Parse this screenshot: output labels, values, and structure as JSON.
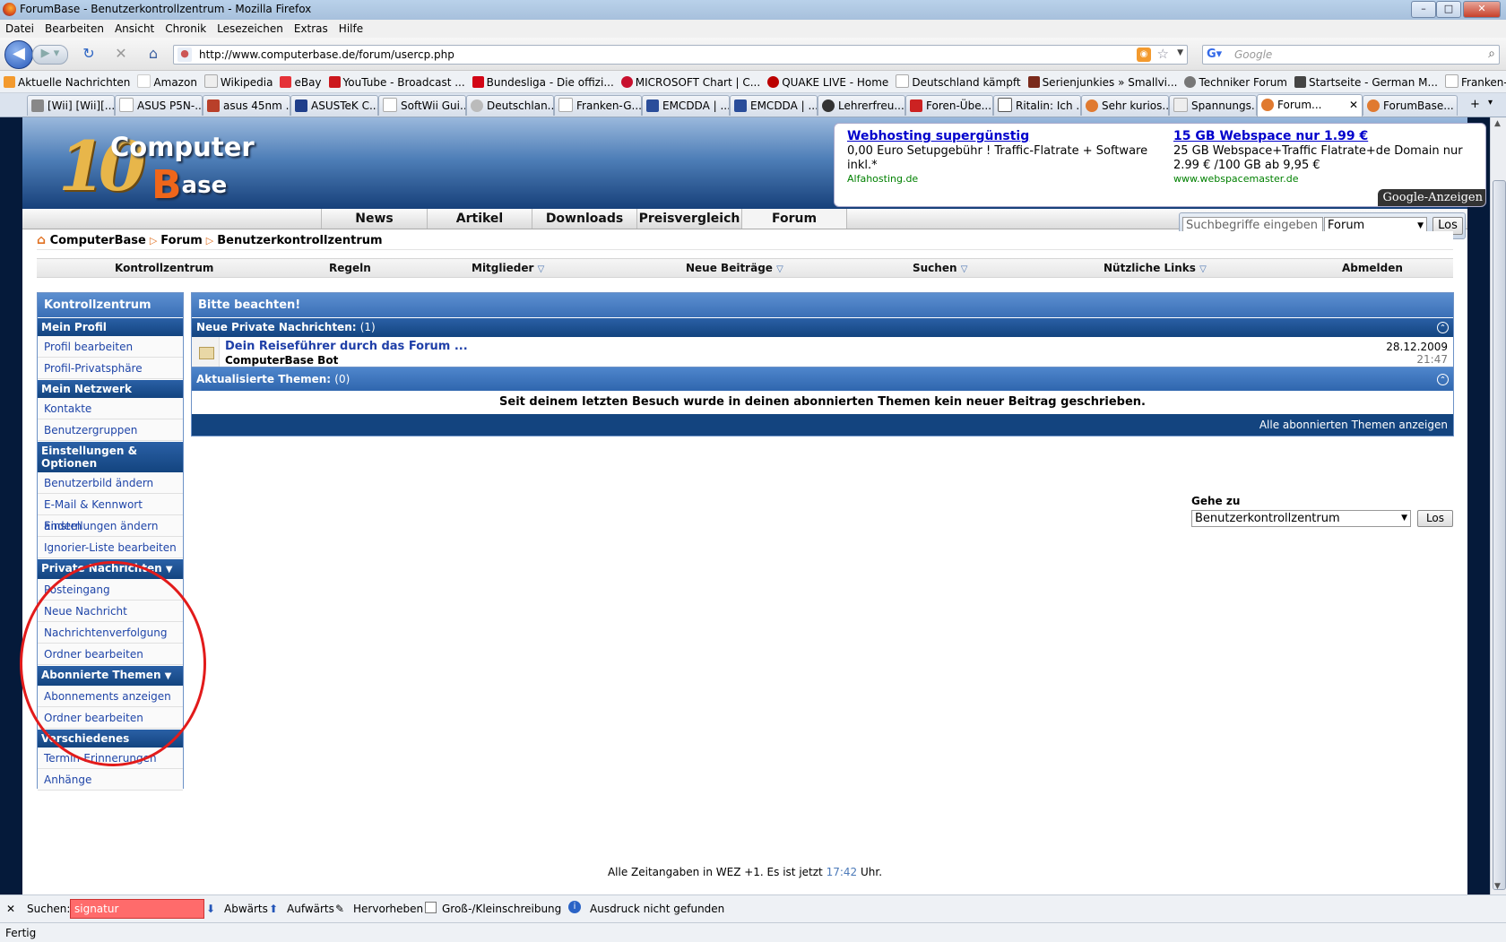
{
  "window": {
    "title": "ForumBase - Benutzerkontrollzentrum - Mozilla Firefox"
  },
  "menu": [
    "Datei",
    "Bearbeiten",
    "Ansicht",
    "Chronik",
    "Lesezeichen",
    "Extras",
    "Hilfe"
  ],
  "url": "http://www.computerbase.de/forum/usercp.php",
  "browser_search": {
    "placeholder": "Google"
  },
  "bookmarks": [
    "Aktuelle Nachrichten",
    "Amazon",
    "Wikipedia",
    "eBay",
    "YouTube - Broadcast ...",
    "Bundesliga - Die offizi...",
    "MICROSOFT Chart | C...",
    "QUAKE LIVE - Home",
    "Deutschland kämpft",
    "Serienjunkies » Smallvi...",
    "Techniker Forum",
    "Startseite - German M...",
    "Franken-Götter :: Index"
  ],
  "tabs": [
    "[Wii] [Wii][...",
    "ASUS P5N-...",
    "asus 45nm ...",
    "ASUSTeK C...",
    "SoftWii Gui...",
    "Deutschlan...",
    "Franken-G...",
    "EMCDDA | ...",
    "EMCDDA | ...",
    "Lehrerfreu...",
    "Foren-Übe...",
    "Ritalin: Ich ...",
    "Sehr kurios...",
    "Spannungs...",
    "Forum...",
    "ForumBase..."
  ],
  "ads": [
    {
      "headline": "Webhosting supergünstig",
      "text": "0,00 Euro Setupgebühr ! Traffic-Flatrate + Software inkl.*",
      "url": "Alfahosting.de"
    },
    {
      "headline": "15 GB Webspace nur 1.99 €",
      "text": "25 GB Webspace+Traffic Flatrate+de Domain nur 2.99 € /100 GB ab 9,95 €",
      "url": "www.webspacemaster.de"
    }
  ],
  "ad_label": {
    "brand": "Google",
    "suffix": "-Anzeigen"
  },
  "main_nav": [
    "News",
    "Artikel",
    "Downloads",
    "Preisvergleich",
    "Forum"
  ],
  "site_search": {
    "placeholder": "Suchbegriffe eingeben",
    "scope": "Forum",
    "button": "Los"
  },
  "breadcrumb": [
    "ComputerBase",
    "Forum",
    "Benutzerkontrollzentrum"
  ],
  "ucp_nav": [
    "Kontrollzentrum",
    "Regeln",
    "Mitglieder",
    "Neue Beiträge",
    "Suchen",
    "Nützliche Links",
    "Abmelden"
  ],
  "sidebar": {
    "title": "Kontrollzentrum",
    "sections": [
      {
        "heading": "Mein Profil",
        "items": [
          "Profil bearbeiten",
          "Profil-Privatsphäre"
        ]
      },
      {
        "heading": "Mein Netzwerk",
        "items": [
          "Kontakte",
          "Benutzergruppen"
        ]
      },
      {
        "heading": "Einstellungen & Optionen",
        "items": [
          "Benutzerbild ändern",
          "E-Mail & Kennwort ändern",
          "Einstellungen ändern",
          "Ignorier-Liste bearbeiten"
        ]
      },
      {
        "heading": "Private Nachrichten",
        "items": [
          "Posteingang",
          "Neue Nachricht",
          "Nachrichtenverfolgung",
          "Ordner bearbeiten"
        ]
      },
      {
        "heading": "Abonnierte Themen",
        "items": [
          "Abonnements anzeigen",
          "Ordner bearbeiten"
        ]
      },
      {
        "heading": "Verschiedenes",
        "items": [
          "Termin-Erinnerungen",
          "Anhänge"
        ]
      }
    ]
  },
  "notice": {
    "title": "Bitte beachten!",
    "pm_heading": "Neue Private Nachrichten:",
    "pm_count": "(1)",
    "message": {
      "title": "Dein Reiseführer durch das Forum ...",
      "sender": "ComputerBase Bot",
      "date": "28.12.2009",
      "time": "21:47"
    }
  },
  "subscribed": {
    "heading": "Aktualisierte Themen:",
    "count": "(0)",
    "empty_text": "Seit deinem letzten Besuch wurde in deinen abonnierten Themen kein neuer Beitrag geschrieben.",
    "footer_link": "Alle abonnierten Themen anzeigen"
  },
  "goto": {
    "label": "Gehe zu",
    "value": "Benutzerkontrollzentrum",
    "button": "Los"
  },
  "time_info": {
    "prefix": "Alle Zeitangaben in WEZ +1. Es ist jetzt",
    "time": "17:42",
    "suffix": "Uhr."
  },
  "findbar": {
    "label": "Suchen:",
    "value": "signatur",
    "down": "Abwärts",
    "up": "Aufwärts",
    "highlight": "Hervorheben",
    "matchcase": "Groß-/Kleinschreibung",
    "status": "Ausdruck nicht gefunden"
  },
  "status": "Fertig"
}
